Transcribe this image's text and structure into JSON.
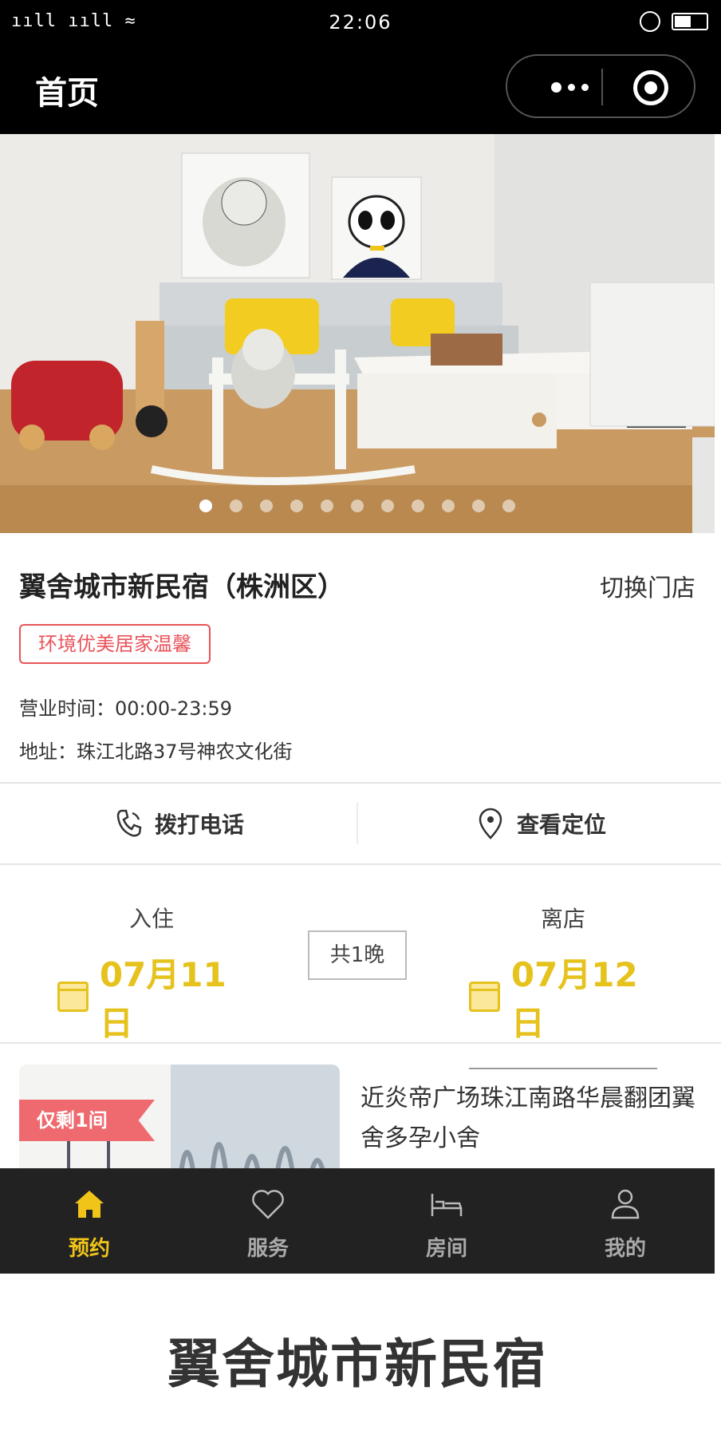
{
  "status_bar": {
    "signal": "ııll ııll ≈",
    "time": "22:06"
  },
  "nav": {
    "title": "首页"
  },
  "banner": {
    "slide_count": 11,
    "active_slide": 1
  },
  "shop": {
    "name": "翼舍城市新民宿（株洲区）",
    "switch_store": "切换门店",
    "tag": "环境优美居家温馨",
    "hours": "营业时间：00:00-23:59",
    "address": "地址：珠江北路37号神农文化街"
  },
  "actions": {
    "call": "拨打电话",
    "location": "查看定位"
  },
  "dates": {
    "checkin_label": "入住",
    "checkin_value": "07月11日",
    "nights": "共1晚",
    "checkout_label": "离店",
    "checkout_value": "07月12日"
  },
  "room": {
    "badge": "仅剩1间",
    "title": "近炎帝广场珠江南路华晨翻团翼舍多孕小舍"
  },
  "tabbar": {
    "items": [
      {
        "label": "预约",
        "icon": "home-icon",
        "active": true
      },
      {
        "label": "服务",
        "icon": "heart-icon",
        "active": false
      },
      {
        "label": "房间",
        "icon": "bed-icon",
        "active": false
      },
      {
        "label": "我的",
        "icon": "user-icon",
        "active": false
      }
    ]
  },
  "footer": {
    "title": "翼舍城市新民宿"
  },
  "colors": {
    "accent_yellow": "#e6c21d",
    "tag_red": "#e8535a",
    "tabbar_bg": "#222222"
  }
}
